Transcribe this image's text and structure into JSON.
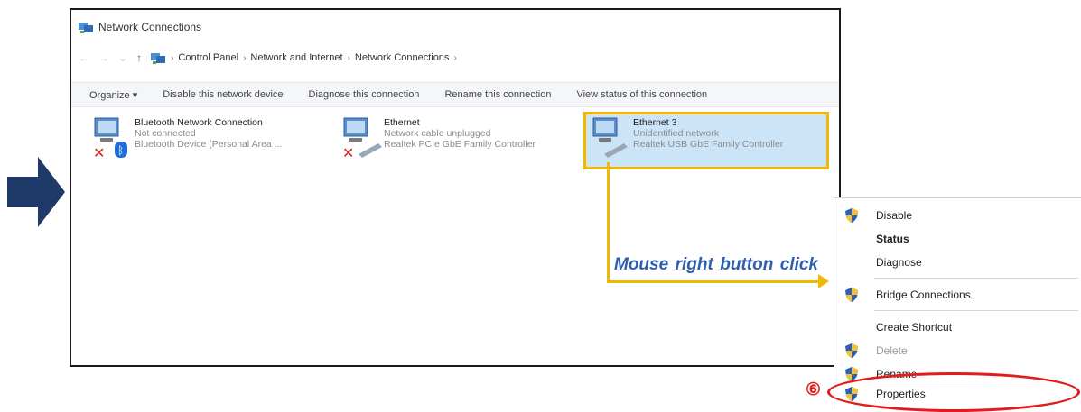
{
  "window": {
    "title": "Network Connections"
  },
  "address_bar": {
    "crumbs": [
      "Control Panel",
      "Network and Internet",
      "Network Connections"
    ]
  },
  "command_bar": {
    "items": [
      "Organize ▾",
      "Disable this network device",
      "Diagnose this connection",
      "Rename this connection",
      "View status of this connection"
    ]
  },
  "connections": [
    {
      "name": "Bluetooth Network Connection",
      "status": "Not connected",
      "device": "Bluetooth Device (Personal Area ...",
      "icon": "bluetooth-network-icon"
    },
    {
      "name": "Ethernet",
      "status": "Network cable unplugged",
      "device": "Realtek PCIe GbE Family Controller",
      "icon": "ethernet-icon"
    },
    {
      "name": "Ethernet 3",
      "status": "Unidentified network",
      "device": "Realtek USB GbE Family Controller",
      "icon": "ethernet-icon",
      "selected": true
    }
  ],
  "callout": {
    "text": "Mouse right button click"
  },
  "context_menu": {
    "items": [
      {
        "label": "Disable",
        "shield": true
      },
      {
        "label": "Status",
        "bold": true
      },
      {
        "label": "Diagnose"
      },
      {
        "label": "Bridge Connections",
        "shield": true
      },
      {
        "label": "Create Shortcut"
      },
      {
        "label": "Delete",
        "shield": true,
        "disabled": true
      },
      {
        "label": "Rename",
        "shield": true
      },
      {
        "label": "Properties",
        "shield": true
      }
    ]
  },
  "step_marker": "⑥",
  "colors": {
    "highlight": "#f2b705",
    "selection": "#cce4f7",
    "annotation_red": "#e31b1b",
    "arrow": "#1f3a68",
    "callout_text": "#2d5fae"
  }
}
